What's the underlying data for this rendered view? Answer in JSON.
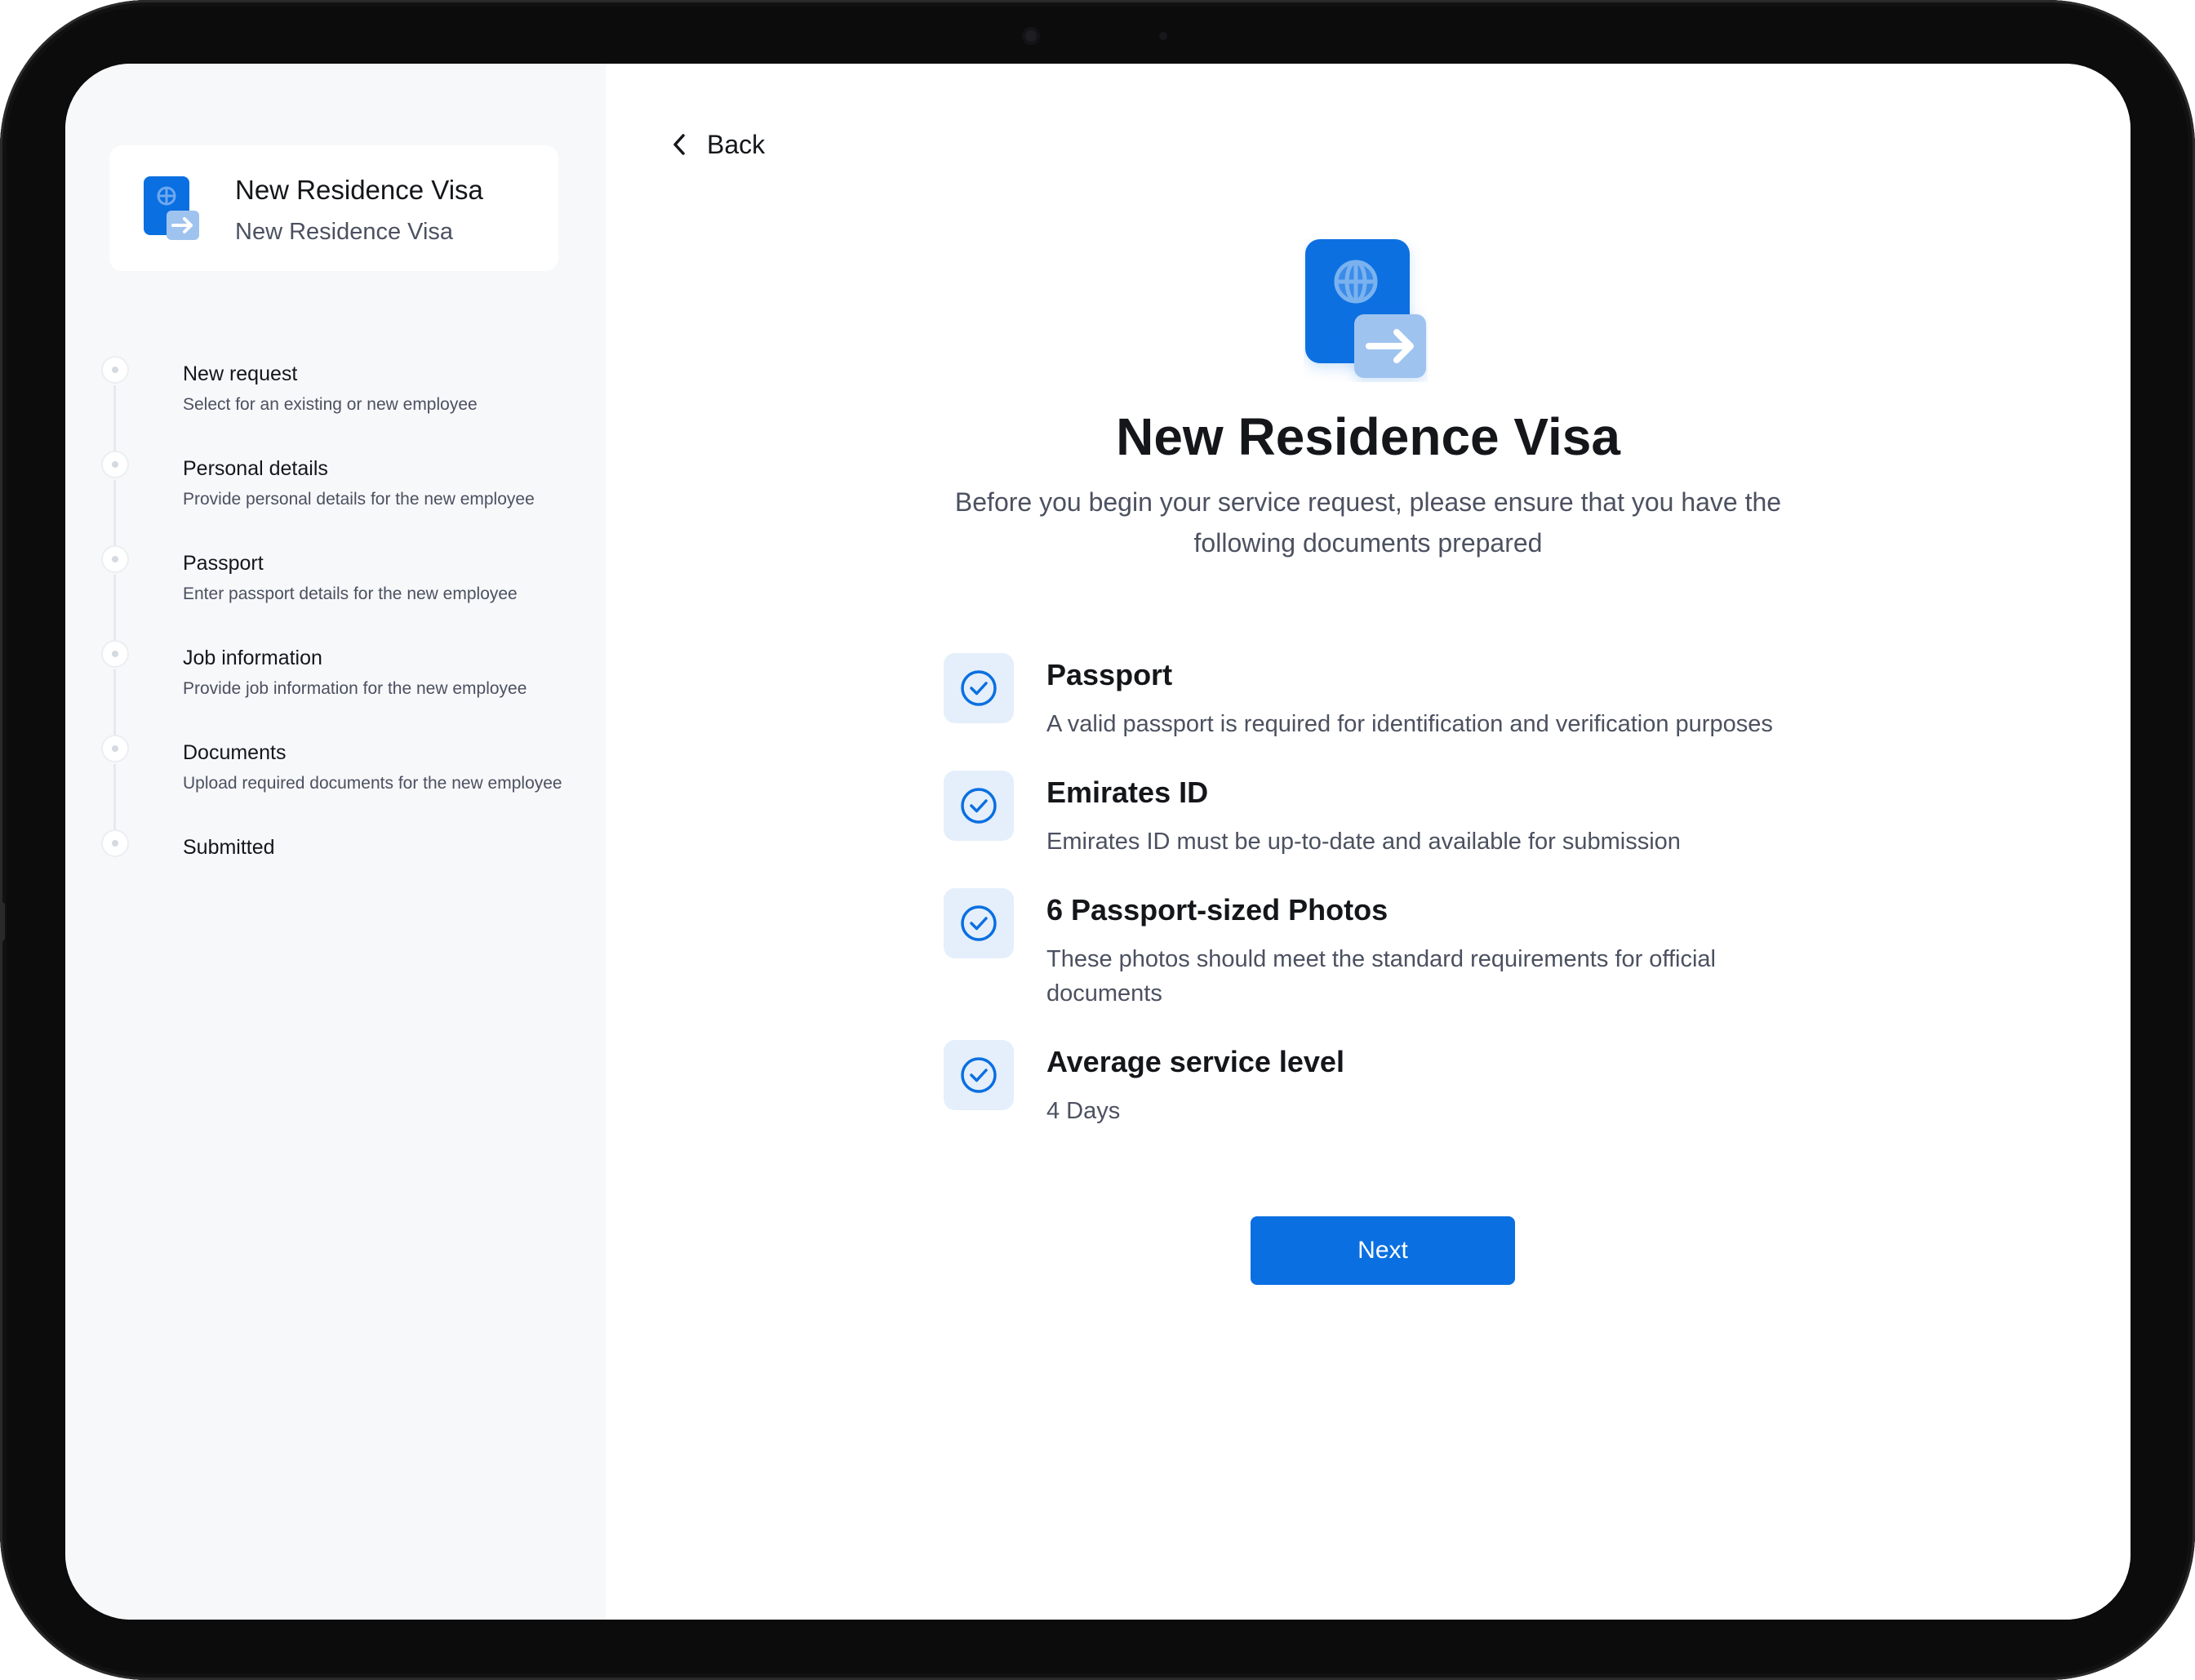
{
  "colors": {
    "accent": "#0a6fe1",
    "badge_bg": "#e4effb",
    "sidebar_bg": "#f7f8fa"
  },
  "sidebar": {
    "card": {
      "icon": "passport-arrow-icon",
      "title": "New Residence Visa",
      "subtitle": "New Residence Visa"
    },
    "steps": [
      {
        "title": "New request",
        "description": "Select for an existing or new employee"
      },
      {
        "title": "Personal details",
        "description": "Provide personal details for the new employee"
      },
      {
        "title": "Passport",
        "description": "Enter passport details for the new employee"
      },
      {
        "title": "Job information",
        "description": "Provide job information for the new employee"
      },
      {
        "title": "Documents",
        "description": "Upload required documents for the new employee"
      },
      {
        "title": "Submitted",
        "description": ""
      }
    ]
  },
  "main": {
    "back_label": "Back",
    "back_icon": "chevron-left-icon",
    "hero_icon": "passport-arrow-icon",
    "title": "New Residence Visa",
    "subtitle_line1": "Before you begin your service request, please ensure that you have the",
    "subtitle_line2": "following documents prepared",
    "requirements": [
      {
        "icon": "check-circle-icon",
        "title": "Passport",
        "description": "A valid passport is required for identification and verification purposes"
      },
      {
        "icon": "check-circle-icon",
        "title": "Emirates ID",
        "description": "Emirates ID must be up-to-date and available for submission"
      },
      {
        "icon": "check-circle-icon",
        "title": "6 Passport-sized Photos",
        "description": "These photos should meet the standard requirements for official documents"
      },
      {
        "icon": "check-circle-icon",
        "title": "Average service level",
        "description": "4 Days"
      }
    ],
    "next_label": "Next"
  }
}
